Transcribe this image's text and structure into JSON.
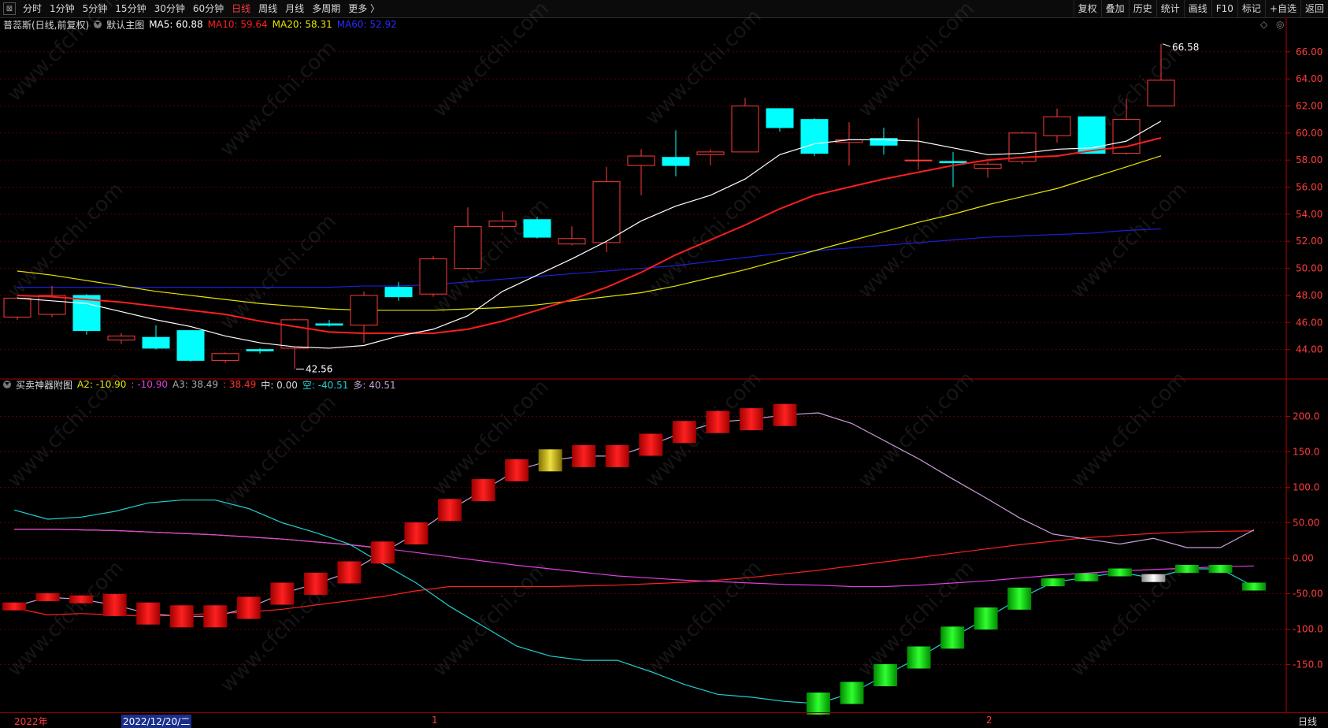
{
  "toolbar": {
    "periods": [
      "分时",
      "1分钟",
      "5分钟",
      "15分钟",
      "30分钟",
      "60分钟",
      "日线",
      "周线",
      "月线",
      "多周期",
      "更多 〉"
    ],
    "active_period": "日线",
    "right_buttons": [
      "复权",
      "叠加",
      "历史",
      "统计",
      "画线",
      "F10",
      "标记",
      "+自选",
      "返回"
    ]
  },
  "main_legend": {
    "title": "普蕊斯(日线,前复权)",
    "chart_name": "默认主图",
    "ma5": "MA5: 60.88",
    "ma10": "MA10: 59.64",
    "ma20": "MA20: 58.31",
    "ma60": "MA60: 52.92"
  },
  "sub_legend": {
    "title": "买卖神器附图",
    "a2_label": "A2:",
    "a2_value": "-10.90",
    "a2b": ": -10.90",
    "a3_label": "A3:",
    "a3_value": "38.49",
    "a3b": ": 38.49",
    "zhong": "中: 0.00",
    "kong_label": "空:",
    "kong_value": "-40.51",
    "duo": "多: 40.51"
  },
  "bottom": {
    "year_label": "2022年",
    "cursor_date": "2022/12/20/二",
    "month1": "1",
    "month2": "2",
    "period_tag": "日线"
  },
  "watermark_text": "www.cfchi.com",
  "colors": {
    "up": "#ff3c3c",
    "down": "#00ffff",
    "ma5": "#ffffff",
    "ma10": "#ff1e1e",
    "ma20": "#e6e600",
    "ma60": "#1e1edc",
    "grid": "#5a0000",
    "axis": "#b40000"
  },
  "chart_data": [
    {
      "type": "candlestick",
      "title": "普蕊斯(日线,前复权)",
      "ylim": [
        42,
        67.5
      ],
      "y_ticks": [
        "44.00",
        "46.00",
        "48.00",
        "50.00",
        "52.00",
        "54.00",
        "56.00",
        "58.00",
        "60.00",
        "62.00",
        "64.00",
        "66.00"
      ],
      "annotations": {
        "high": "66.58",
        "low": "42.56"
      },
      "candles": [
        {
          "o": 46.4,
          "h": 47.9,
          "l": 46.2,
          "c": 47.8
        },
        {
          "o": 46.6,
          "h": 48.7,
          "l": 46.4,
          "c": 48.0
        },
        {
          "o": 48.0,
          "h": 48.1,
          "l": 45.1,
          "c": 45.4
        },
        {
          "o": 44.7,
          "h": 45.2,
          "l": 44.4,
          "c": 45.0
        },
        {
          "o": 44.9,
          "h": 45.8,
          "l": 44.0,
          "c": 44.1
        },
        {
          "o": 45.4,
          "h": 45.4,
          "l": 43.1,
          "c": 43.2
        },
        {
          "o": 43.2,
          "h": 43.8,
          "l": 43.0,
          "c": 43.7
        },
        {
          "o": 44.0,
          "h": 44.1,
          "l": 43.7,
          "c": 43.9
        },
        {
          "o": 44.1,
          "h": 46.3,
          "l": 42.56,
          "c": 46.2
        },
        {
          "o": 45.9,
          "h": 46.2,
          "l": 45.7,
          "c": 45.8
        },
        {
          "o": 45.8,
          "h": 48.3,
          "l": 44.5,
          "c": 48.0
        },
        {
          "o": 48.6,
          "h": 49.0,
          "l": 47.6,
          "c": 47.9
        },
        {
          "o": 48.1,
          "h": 50.9,
          "l": 47.9,
          "c": 50.7
        },
        {
          "o": 50.0,
          "h": 54.5,
          "l": 49.9,
          "c": 53.1
        },
        {
          "o": 53.1,
          "h": 54.2,
          "l": 52.9,
          "c": 53.5
        },
        {
          "o": 53.6,
          "h": 53.8,
          "l": 52.2,
          "c": 52.3
        },
        {
          "o": 51.8,
          "h": 53.1,
          "l": 51.7,
          "c": 52.2
        },
        {
          "o": 51.9,
          "h": 57.5,
          "l": 51.2,
          "c": 56.4
        },
        {
          "o": 57.6,
          "h": 58.8,
          "l": 55.4,
          "c": 58.3
        },
        {
          "o": 58.2,
          "h": 60.2,
          "l": 56.8,
          "c": 57.6
        },
        {
          "o": 58.4,
          "h": 58.8,
          "l": 57.6,
          "c": 58.6
        },
        {
          "o": 58.6,
          "h": 62.6,
          "l": 58.6,
          "c": 62.0
        },
        {
          "o": 61.8,
          "h": 61.8,
          "l": 60.1,
          "c": 60.4
        },
        {
          "o": 61.0,
          "h": 61.1,
          "l": 58.3,
          "c": 58.5
        },
        {
          "o": 59.3,
          "h": 60.8,
          "l": 57.6,
          "c": 59.5
        },
        {
          "o": 59.6,
          "h": 60.4,
          "l": 58.4,
          "c": 59.1
        },
        {
          "o": 58.0,
          "h": 61.1,
          "l": 57.3,
          "c": 58.0
        },
        {
          "o": 57.9,
          "h": 58.6,
          "l": 56.0,
          "c": 57.8
        },
        {
          "o": 57.4,
          "h": 57.9,
          "l": 56.7,
          "c": 57.7
        },
        {
          "o": 57.9,
          "h": 60.1,
          "l": 57.7,
          "c": 60.0
        },
        {
          "o": 59.8,
          "h": 61.8,
          "l": 59.3,
          "c": 61.2
        },
        {
          "o": 61.2,
          "h": 61.2,
          "l": 58.5,
          "c": 58.5
        },
        {
          "o": 58.5,
          "h": 62.5,
          "l": 58.4,
          "c": 61.0
        },
        {
          "o": 62.0,
          "h": 66.58,
          "l": 62.0,
          "c": 63.9
        }
      ],
      "ma5": [
        47.8,
        47.6,
        47.4,
        46.8,
        46.2,
        45.7,
        45.0,
        44.5,
        44.2,
        44.1,
        44.3,
        45.0,
        45.5,
        46.5,
        48.3,
        49.5,
        50.7,
        52.0,
        53.5,
        54.6,
        55.4,
        56.6,
        58.4,
        59.2,
        59.5,
        59.5,
        59.4,
        58.9,
        58.4,
        58.5,
        58.8,
        58.9,
        59.4,
        60.88
      ],
      "ma10": [
        48.0,
        47.9,
        47.7,
        47.5,
        47.2,
        46.9,
        46.6,
        46.1,
        45.7,
        45.3,
        45.2,
        45.2,
        45.2,
        45.5,
        46.1,
        46.9,
        47.7,
        48.6,
        49.7,
        51.0,
        52.1,
        53.2,
        54.4,
        55.4,
        56.0,
        56.6,
        57.1,
        57.6,
        58.0,
        58.2,
        58.3,
        58.7,
        59.0,
        59.64
      ],
      "ma20": [
        49.8,
        49.5,
        49.1,
        48.7,
        48.3,
        48.0,
        47.7,
        47.4,
        47.2,
        47.0,
        46.9,
        46.9,
        46.9,
        47.0,
        47.1,
        47.3,
        47.6,
        47.9,
        48.2,
        48.7,
        49.3,
        49.9,
        50.6,
        51.3,
        52.0,
        52.7,
        53.4,
        54.0,
        54.7,
        55.3,
        55.9,
        56.7,
        57.5,
        58.31
      ],
      "ma60": [
        48.6,
        48.6,
        48.6,
        48.6,
        48.6,
        48.6,
        48.6,
        48.6,
        48.6,
        48.6,
        48.7,
        48.7,
        48.8,
        49.0,
        49.2,
        49.4,
        49.6,
        49.8,
        50.0,
        50.2,
        50.5,
        50.8,
        51.1,
        51.3,
        51.5,
        51.7,
        51.9,
        52.1,
        52.3,
        52.4,
        52.5,
        52.6,
        52.8,
        52.92
      ]
    },
    {
      "type": "indicator",
      "title": "买卖神器附图",
      "ylim": [
        -215,
        235
      ],
      "y_ticks": [
        "200.0",
        "150.0",
        "100.0",
        "50.00",
        "0.00",
        "-50.00",
        "-100.0",
        "-150.0"
      ],
      "kong_line": [
        68,
        55,
        58,
        66,
        78,
        82,
        82,
        70,
        50,
        36,
        20,
        -8,
        -35,
        -68,
        -96,
        -124,
        -138,
        -144,
        -144,
        -160,
        -178,
        -192,
        -196,
        -202,
        -205,
        -190,
        -165,
        -140,
        -112,
        -85,
        -57,
        -34,
        -27,
        -20,
        -28,
        -15,
        -15,
        -40
      ],
      "duo_line": [
        -68,
        -55,
        -58,
        -66,
        -78,
        -82,
        -82,
        -70,
        -50,
        -36,
        -20,
        8,
        35,
        68,
        96,
        124,
        138,
        144,
        144,
        160,
        178,
        192,
        196,
        202,
        205,
        190,
        165,
        140,
        112,
        85,
        57,
        34,
        27,
        20,
        28,
        15,
        15,
        40
      ],
      "a2_line": [
        41,
        41,
        40,
        39,
        37,
        35,
        33,
        30,
        27,
        23,
        19,
        14,
        8,
        2,
        -4,
        -10,
        -15,
        -20,
        -25,
        -28,
        -31,
        -33,
        -35,
        -37,
        -38,
        -40,
        -40,
        -38,
        -35,
        -32,
        -28,
        -24,
        -21,
        -18,
        -16,
        -14,
        -12,
        -10.9
      ],
      "a3_line": [
        -70,
        -80,
        -78,
        -80,
        -82,
        -80,
        -78,
        -76,
        -72,
        -66,
        -60,
        -54,
        -46,
        -40,
        -40,
        -40,
        -40,
        -39,
        -38,
        -36,
        -34,
        -31,
        -27,
        -22,
        -17,
        -11,
        -5,
        1,
        7,
        13,
        19,
        24,
        29,
        32,
        35,
        37,
        38,
        38.49
      ]
    }
  ]
}
